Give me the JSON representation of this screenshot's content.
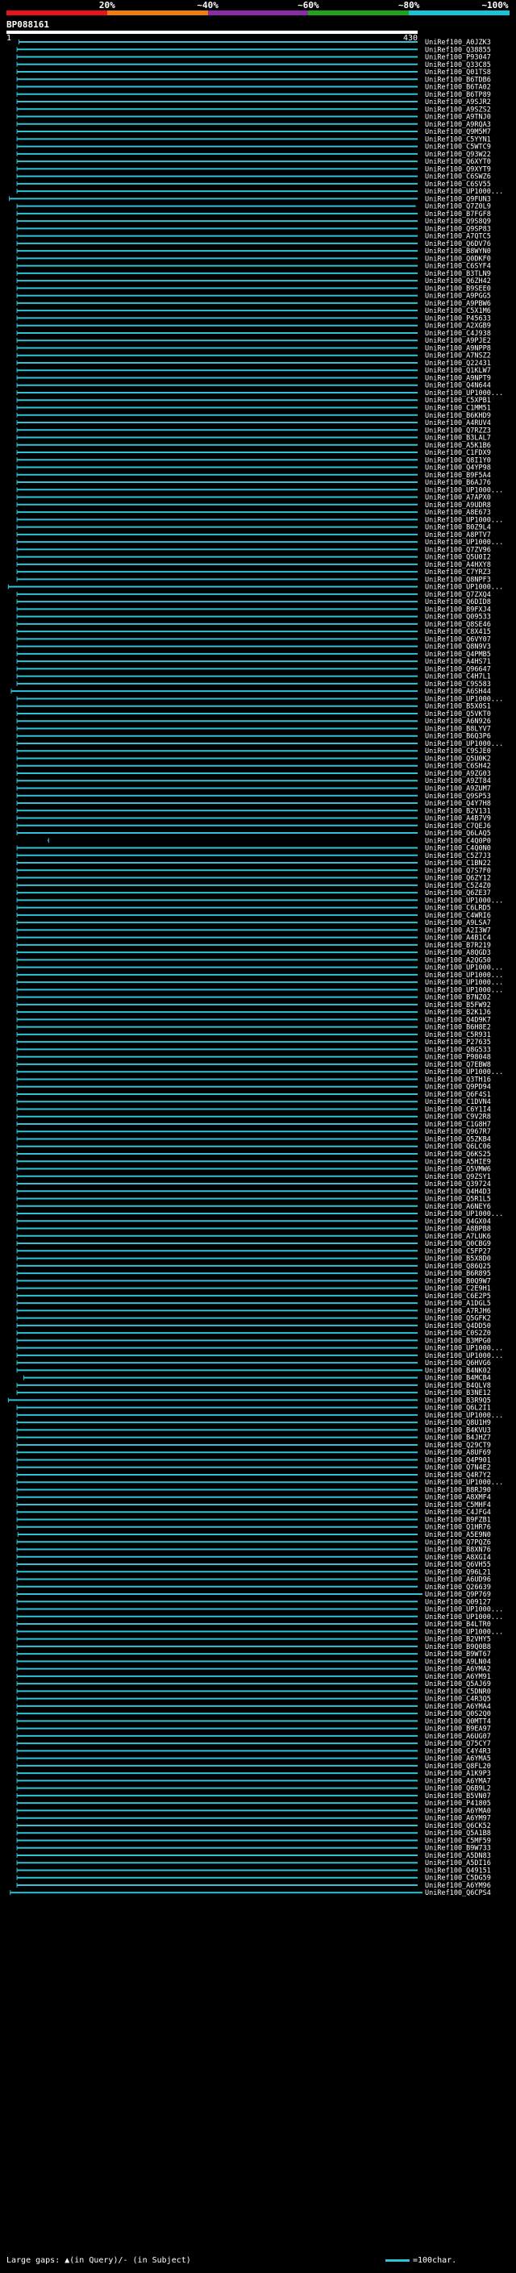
{
  "legend": {
    "ticks": [
      "20%",
      "~40%",
      "~60%",
      "~80%",
      "~100%"
    ],
    "colors": [
      "#e8141b",
      "#f07d10",
      "#8b2ba8",
      "#1fa31f",
      "#18c4d8"
    ]
  },
  "query": {
    "id": "BP088161",
    "scale_start": "1",
    "scale_end": "430",
    "length": 430
  },
  "footer": {
    "text": "Large gaps: ▲(in Query)/- (in Subject)",
    "key": "=100char."
  },
  "chart_data": {
    "type": "alignment",
    "x_range": [
      1,
      430
    ],
    "hit_color": "#2ec4d6",
    "hits": [
      "UniRef100_A0JZK3",
      "UniRef100_Q38855",
      "UniRef100_P93047",
      "UniRef100_Q33C85",
      "UniRef100_Q01TS8",
      "UniRef100_B6TDB6",
      "UniRef100_B6TA02",
      "UniRef100_B6TP89",
      "UniRef100_A9SJR2",
      "UniRef100_A9SZS2",
      "UniRef100_A9TNJ0",
      "UniRef100_A9RQA3",
      "UniRef100_Q9M5M7",
      "UniRef100_C5YYN1",
      "UniRef100_C5WTC9",
      "UniRef100_Q93W22",
      "UniRef100_Q6XYT0",
      "UniRef100_Q9XYT9",
      "UniRef100_C6SWZ6",
      "UniRef100_C6SV55",
      "UniRef100_UP1000...",
      "UniRef100_Q9FUN3",
      "UniRef100_Q7Z0L9",
      "UniRef100_B7FGF8",
      "UniRef100_Q9S8Q9",
      "UniRef100_Q9SP83",
      "UniRef100_A7QTC5",
      "UniRef100_Q6DV76",
      "UniRef100_B8WYN0",
      "UniRef100_Q0DKF0",
      "UniRef100_C6SYF4",
      "UniRef100_B3TLN9",
      "UniRef100_Q6ZH42",
      "UniRef100_B9SEE0",
      "UniRef100_A9PGG5",
      "UniRef100_A9PBW6",
      "UniRef100_C5X1M6",
      "UniRef100_P45633",
      "UniRef100_A2XGB9",
      "UniRef100_C4J938",
      "UniRef100_A9PJE2",
      "UniRef100_A9NPP8",
      "UniRef100_A7NSZ2",
      "UniRef100_Q22431",
      "UniRef100_Q1KLW7",
      "UniRef100_A9NPT9",
      "UniRef100_Q4N644",
      "UniRef100_UP1000...",
      "UniRef100_C5XPB1",
      "UniRef100_C1MM51",
      "UniRef100_B6KHD9",
      "UniRef100_A4RUV4",
      "UniRef100_Q7RZZ3",
      "UniRef100_B3LAL7",
      "UniRef100_A5K1B6",
      "UniRef100_C1FDX9",
      "UniRef100_Q8I1Y0",
      "UniRef100_Q4YP98",
      "UniRef100_B9F5A4",
      "UniRef100_B6AJ76",
      "UniRef100_UP1000...",
      "UniRef100_A7APX0",
      "UniRef100_A9UDR8",
      "UniRef100_A8E673",
      "UniRef100_UP1000...",
      "UniRef100_B0Z9L4",
      "UniRef100_A8PTV7",
      "UniRef100_UP1000...",
      "UniRef100_Q7ZV96",
      "UniRef100_Q5U0I2",
      "UniRef100_A4HXY8",
      "UniRef100_C7YRZ3",
      "UniRef100_Q8NPF3",
      "UniRef100_UP1000...",
      "UniRef100_Q7ZXQ4",
      "UniRef100_Q6DID8",
      "UniRef100_B9FXJ4",
      "UniRef100_Q09533",
      "UniRef100_Q8SE46",
      "UniRef100_C8X415",
      "UniRef100_Q6VY07",
      "UniRef100_Q8N9V3",
      "UniRef100_Q4PMB5",
      "UniRef100_A4HS71",
      "UniRef100_Q96647",
      "UniRef100_C4H7L1",
      "UniRef100_C9S583",
      "UniRef100_A6SH44",
      "UniRef100_UP1000...",
      "UniRef100_B5X0S1",
      "UniRef100_Q5VKT0",
      "UniRef100_A6N926",
      "UniRef100_B8LYV7",
      "UniRef100_B6Q3P6",
      "UniRef100_UP1000...",
      "UniRef100_C9SJE0",
      "UniRef100_Q5U0K2",
      "UniRef100_C6SH42",
      "UniRef100_A9ZG03",
      "UniRef100_A9ZT84",
      "UniRef100_A9ZUM7",
      "UniRef100_Q9SP53",
      "UniRef100_Q4Y7H8",
      "UniRef100_B2V131",
      "UniRef100_A4B7V9",
      "UniRef100_C7QEJ6",
      "UniRef100_Q6LAQ5",
      "UniRef100_C4Q0P0",
      "UniRef100_C4Q0N0",
      "UniRef100_C5Z7J3",
      "UniRef100_C1BN22",
      "UniRef100_Q7S7F0",
      "UniRef100_Q6ZY12",
      "UniRef100_C5Z4Z0",
      "UniRef100_Q6ZE37",
      "UniRef100_UP1000...",
      "UniRef100_C6LRD5",
      "UniRef100_C4WRI6",
      "UniRef100_A9LSA7",
      "UniRef100_A2I3W7",
      "UniRef100_A4B1C4",
      "UniRef100_B7R219",
      "UniRef100_A8QGD3",
      "UniRef100_A2QG50",
      "UniRef100_UP1000...",
      "UniRef100_UP1000...",
      "UniRef100_UP1000...",
      "UniRef100_UP1000...",
      "UniRef100_B7NZ02",
      "UniRef100_B5FW92",
      "UniRef100_B2K1J6",
      "UniRef100_Q4D9K7",
      "UniRef100_B6H8E2",
      "UniRef100_C5R931",
      "UniRef100_P27635",
      "UniRef100_Q8G533",
      "UniRef100_P98048",
      "UniRef100_Q7EBW8",
      "UniRef100_UP1000...",
      "UniRef100_Q3TH16",
      "UniRef100_Q9PD94",
      "UniRef100_Q6F4S1",
      "UniRef100_C1DVN4",
      "UniRef100_C6Y1I4",
      "UniRef100_C9V2R8",
      "UniRef100_C1G8H7",
      "UniRef100_Q967R7",
      "UniRef100_Q5ZKB4",
      "UniRef100_Q6LC06",
      "UniRef100_Q6KS25",
      "UniRef100_A5HIE9",
      "UniRef100_Q5VMW6",
      "UniRef100_Q9ZSY1",
      "UniRef100_Q39724",
      "UniRef100_Q4H4D3",
      "UniRef100_Q5R1L5",
      "UniRef100_A6NEY6",
      "UniRef100_UP1000...",
      "UniRef100_Q4GX04",
      "UniRef100_A8BPB8",
      "UniRef100_A7LUK6",
      "UniRef100_Q0CBG9",
      "UniRef100_C5FP27",
      "UniRef100_B5X8D0",
      "UniRef100_Q86Q25",
      "UniRef100_B6R895",
      "UniRef100_B0Q9W7",
      "UniRef100_C2E9H1",
      "UniRef100_C6E2P5",
      "UniRef100_A1DGL5",
      "UniRef100_A7RJH6",
      "UniRef100_Q5GFK2",
      "UniRef100_Q4DD50",
      "UniRef100_C0S2Z0",
      "UniRef100_B3MPG0",
      "UniRef100_UP1000...",
      "UniRef100_UP1000...",
      "UniRef100_Q6HVG6",
      "UniRef100_B4NK02",
      "UniRef100_B4MCB4",
      "UniRef100_B4QLV8",
      "UniRef100_B3NE12",
      "UniRef100_B3R9Q5",
      "UniRef100_Q6L2I1",
      "UniRef100_UP1000...",
      "UniRef100_Q8U1H9",
      "UniRef100_B4KVU3",
      "UniRef100_B4JHZ7",
      "UniRef100_Q29CT9",
      "UniRef100_A8UF69",
      "UniRef100_Q4P901",
      "UniRef100_Q7N4E2",
      "UniRef100_Q4R7Y2",
      "UniRef100_UP1000...",
      "UniRef100_B8RJ90",
      "UniRef100_A8XMF4",
      "UniRef100_C5MHF4",
      "UniRef100_C4JFG4",
      "UniRef100_B9FZB1",
      "UniRef100_Q1HR76",
      "UniRef100_A5E9N0",
      "UniRef100_Q7PQZ6",
      "UniRef100_B8XN76",
      "UniRef100_A8XGI4",
      "UniRef100_Q6VH55",
      "UniRef100_Q96L21",
      "UniRef100_A6UD96",
      "UniRef100_Q26639",
      "UniRef100_Q9P769",
      "UniRef100_Q09127",
      "UniRef100_UP1000...",
      "UniRef100_UP1000...",
      "UniRef100_B4LTR0",
      "UniRef100_UP1000...",
      "UniRef100_B2VHY5",
      "UniRef100_B9Q0B8",
      "UniRef100_B9WT67",
      "UniRef100_A9LN04",
      "UniRef100_A6YMA2",
      "UniRef100_A6YM91",
      "UniRef100_Q5AJ69",
      "UniRef100_C5DNR0",
      "UniRef100_C4R3Q5",
      "UniRef100_A6YMA4",
      "UniRef100_Q0S2Q0",
      "UniRef100_Q0MTT4",
      "UniRef100_B9EA97",
      "UniRef100_A6UG07",
      "UniRef100_Q75CY7",
      "UniRef100_C4Y4R3",
      "UniRef100_A6YMA5",
      "UniRef100_Q8FL20",
      "UniRef100_A1K9P3",
      "UniRef100_A6YMA7",
      "UniRef100_Q6B9L2",
      "UniRef100_B5VN07",
      "UniRef100_P41805",
      "UniRef100_A6YMA0",
      "UniRef100_A6YM97",
      "UniRef100_Q6CK52",
      "UniRef100_Q5A1B8",
      "UniRef100_C5MF59",
      "UniRef100_B9W733",
      "UniRef100_A5DN83",
      "UniRef100_A5DI16",
      "UniRef100_Q49151",
      "UniRef100_C5DG59",
      "UniRef100_A6YM96",
      "UniRef100_Q6CPS4"
    ],
    "starts": {
      "0": 14,
      "21": 4,
      "73": 3,
      "87": 6,
      "107": 45,
      "179": 19,
      "182": 3,
      "200": 13,
      "248": 5,
      "252": 20,
      "253": 19,
      "254": 22,
      "260": 10,
      "262": 6,
      "263": 12,
      "264": 14,
      "270": 25,
      "271": 22,
      "272": 22,
      "273": 20,
      "274": 25,
      "275": 28,
      "276": 25,
      "277": 30,
      "278": 30,
      "279": 22,
      "280": 25,
      "281": 22,
      "282": 24,
      "283": 22,
      "284": 25,
      "285": 25,
      "286": 22,
      "287": 14
    },
    "ends": {
      "22": 428,
      "107": 44,
      "178": 440,
      "208": 435,
      "248": 440,
      "252": 435,
      "254": 432,
      "257": 432,
      "270": 430,
      "283": 430,
      "286": 432
    }
  }
}
